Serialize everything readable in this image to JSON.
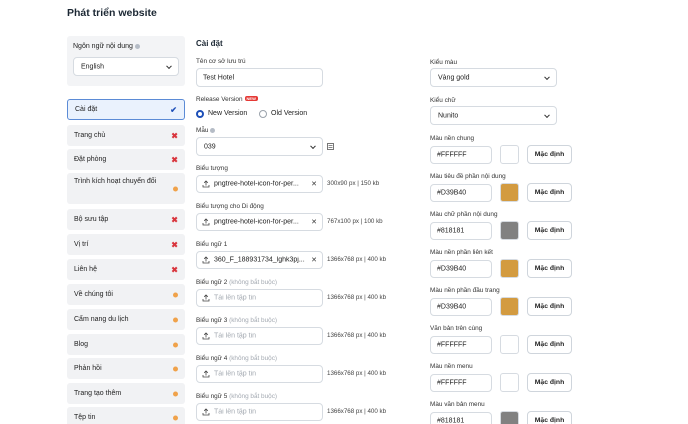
{
  "page": {
    "title": "Phát triển website"
  },
  "language": {
    "label": "Ngôn ngữ nội dung",
    "value": "English"
  },
  "nav": [
    {
      "label": "Cài đặt",
      "status": "ok"
    },
    {
      "label": "Trang chủ",
      "status": "error"
    },
    {
      "label": "Đặt phòng",
      "status": "error"
    },
    {
      "label": "Trình kích hoạt chuyển đổi",
      "status": "pending"
    },
    {
      "label": "Bộ sưu tập",
      "status": "error"
    },
    {
      "label": "Vị trí",
      "status": "error"
    },
    {
      "label": "Liên hệ",
      "status": "error"
    },
    {
      "label": "Về chúng tôi",
      "status": "pending"
    },
    {
      "label": "Cẩm nang du lịch",
      "status": "pending"
    },
    {
      "label": "Blog",
      "status": "pending"
    },
    {
      "label": "Phản hồi",
      "status": "pending"
    },
    {
      "label": "Trang tạo thêm",
      "status": "pending"
    },
    {
      "label": "Tệp tin",
      "status": "pending"
    }
  ],
  "settings": {
    "title": "Cài đặt",
    "property_name": {
      "label": "Tên cơ sở lưu trú",
      "value": "Test Hotel"
    },
    "release": {
      "label": "Release Version",
      "badge": "NEW",
      "options": [
        "New Version",
        "Old Version"
      ],
      "selected": "New Version"
    },
    "template": {
      "label": "Mẫu",
      "value": "039"
    },
    "files": [
      {
        "label": "Biểu tượng",
        "hint": "",
        "value": "pngtree-hotel-icon-for-per...",
        "spec": "300x90 px | 150 kb"
      },
      {
        "label": "Biểu tượng cho Di động",
        "hint": "",
        "value": "pngtree-hotel-icon-for-per...",
        "spec": "767x100 px | 100 kb"
      },
      {
        "label": "Biểu ngữ 1",
        "hint": "",
        "value": "360_F_188931734_lghk3pj...",
        "spec": "1366x768 px | 400 kb"
      },
      {
        "label": "Biểu ngữ 2",
        "hint": "(không bắt buộc)",
        "value": "Tải lên tập tin",
        "spec": "1366x768 px | 400 kb"
      },
      {
        "label": "Biểu ngữ 3",
        "hint": "(không bắt buộc)",
        "value": "Tải lên tập tin",
        "spec": "1366x768 px | 400 kb"
      },
      {
        "label": "Biểu ngữ 4",
        "hint": "(không bắt buộc)",
        "value": "Tải lên tập tin",
        "spec": "1366x768 px | 400 kb"
      },
      {
        "label": "Biểu ngữ 5",
        "hint": "(không bắt buộc)",
        "value": "Tải lên tập tin",
        "spec": "1366x768 px | 400 kb"
      }
    ]
  },
  "style": {
    "theme": {
      "label": "Kiểu màu",
      "value": "Vàng gold"
    },
    "font": {
      "label": "Kiểu chữ",
      "value": "Nunito"
    },
    "default_label": "Mặc định",
    "colors": [
      {
        "label": "Màu nền chung",
        "value": "#FFFFFF"
      },
      {
        "label": "Màu tiêu đề phần nội dung",
        "value": "#D39B40"
      },
      {
        "label": "Màu chữ phần nội dung",
        "value": "#818181"
      },
      {
        "label": "Màu nền phần liên kết",
        "value": "#D39B40"
      },
      {
        "label": "Màu nền phần đầu trang",
        "value": "#D39B40"
      },
      {
        "label": "Văn bản trên cùng",
        "value": "#FFFFFF"
      },
      {
        "label": "Màu nền menu",
        "value": "#FFFFFF"
      },
      {
        "label": "Màu văn bản menu",
        "value": "#818181"
      }
    ]
  },
  "colors": {
    "accent": "#1d4fb8",
    "error": "#d9363e",
    "pending": "#f0a24a"
  }
}
